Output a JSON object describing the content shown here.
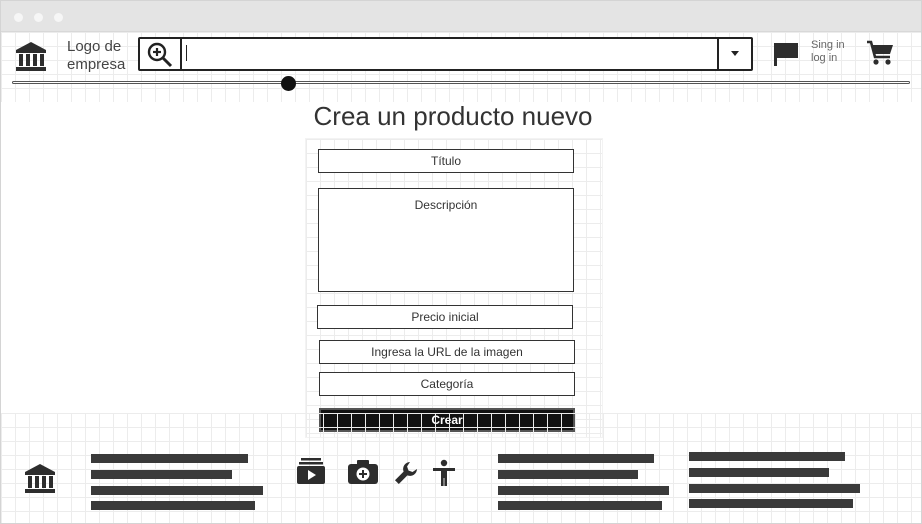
{
  "header": {
    "logo_text": "Logo de empresa",
    "logo_icon": "bank-icon",
    "search": {
      "icon": "zoom-in-icon",
      "value": "",
      "dropdown_icon": "caret-down-icon"
    },
    "flag_icon": "flag-icon",
    "sign_in": "Sing in",
    "log_in": "log in",
    "cart_icon": "shopping-cart-icon",
    "slider_level": 0.31
  },
  "main": {
    "title": "Crea un producto nuevo",
    "form": {
      "title_label": "Título",
      "description_label": "Descripción",
      "price_label": "Precio inicial",
      "image_url_label": "Ingresa la URL de la imagen",
      "category_label": "Categoría",
      "submit_label": "Crear"
    }
  },
  "footer": {
    "logo_icon": "bank-icon",
    "icons": [
      "video-library-icon",
      "add-photo-icon",
      "wrench-icon",
      "accessibility-icon"
    ]
  },
  "colors": {
    "text": "#333333",
    "button_bg": "#111111",
    "titlebar": "#e4e4e4"
  }
}
